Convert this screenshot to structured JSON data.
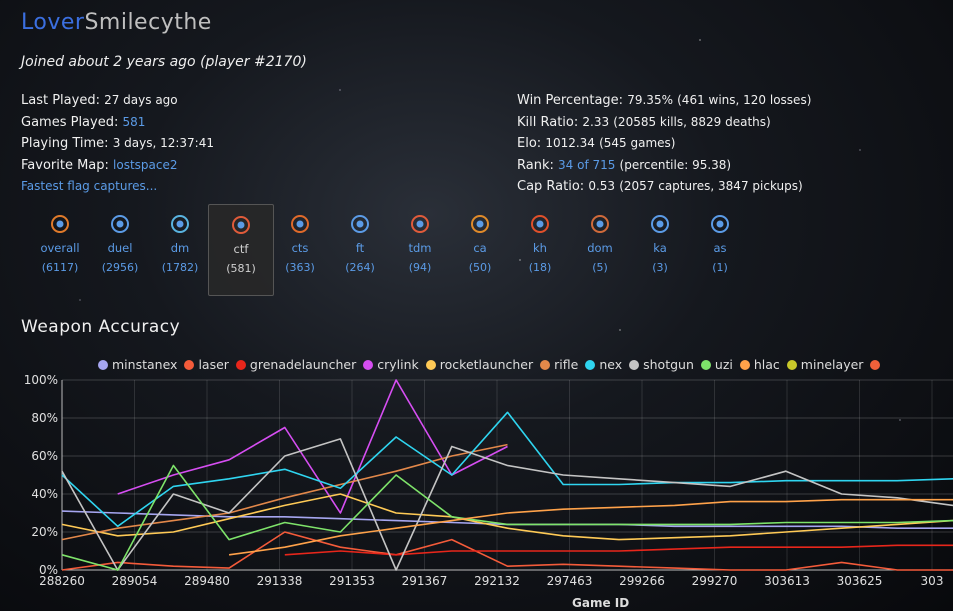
{
  "player": {
    "nick_first": "Lover",
    "nick_last": "Smilecythe",
    "joined": "Joined about 2 years ago (player #2170)"
  },
  "stats_left": {
    "last_played_label": "Last Played:",
    "last_played": "27 days ago",
    "games_played_label": "Games Played:",
    "games_played": "581",
    "playing_time_label": "Playing Time:",
    "playing_time": "3 days, 12:37:41",
    "favorite_map_label": "Favorite Map:",
    "favorite_map": "lostspace2",
    "fastest_flag": "Fastest flag captures..."
  },
  "stats_right": {
    "win_label": "Win Percentage:",
    "win_pct": "79.35%",
    "win_detail": "(461 wins, 120 losses)",
    "kill_label": "Kill Ratio:",
    "kill_ratio": "2.33",
    "kill_detail": "(20585 kills, 8829 deaths)",
    "elo_label": "Elo:",
    "elo": "1012.34",
    "elo_detail": "(545 games)",
    "rank_label": "Rank:",
    "rank": "34 of 715",
    "rank_detail": "(percentile: 95.38)",
    "cap_label": "Cap Ratio:",
    "cap_ratio": "0.53",
    "cap_detail": "(2057 captures, 3847 pickups)"
  },
  "game_modes": [
    {
      "label": "overall",
      "count": "(6117)",
      "icon": "overall-icon",
      "active": false
    },
    {
      "label": "duel",
      "count": "(2956)",
      "icon": "duel-icon",
      "active": false
    },
    {
      "label": "dm",
      "count": "(1782)",
      "icon": "dm-icon",
      "active": false
    },
    {
      "label": "ctf",
      "count": "(581)",
      "icon": "ctf-icon",
      "active": true
    },
    {
      "label": "cts",
      "count": "(363)",
      "icon": "cts-icon",
      "active": false
    },
    {
      "label": "ft",
      "count": "(264)",
      "icon": "ft-icon",
      "active": false
    },
    {
      "label": "tdm",
      "count": "(94)",
      "icon": "tdm-icon",
      "active": false
    },
    {
      "label": "ca",
      "count": "(50)",
      "icon": "ca-icon",
      "active": false
    },
    {
      "label": "kh",
      "count": "(18)",
      "icon": "kh-icon",
      "active": false
    },
    {
      "label": "dom",
      "count": "(5)",
      "icon": "dom-icon",
      "active": false
    },
    {
      "label": "ka",
      "count": "(3)",
      "icon": "ka-icon",
      "active": false
    },
    {
      "label": "as",
      "count": "(1)",
      "icon": "as-icon",
      "active": false
    }
  ],
  "weapon_accuracy_title": "Weapon Accuracy",
  "chart_data": {
    "type": "line",
    "xlabel": "Game ID",
    "ylabel": "",
    "ylim": [
      0,
      100
    ],
    "yticks": [
      "0%",
      "20%",
      "40%",
      "60%",
      "80%",
      "100%"
    ],
    "x_tick_labels": [
      "288260",
      "289054",
      "289480",
      "291338",
      "291353",
      "291367",
      "292132",
      "297463",
      "299266",
      "299270",
      "303613",
      "303625",
      "303"
    ],
    "grid": true,
    "legend_position": "top",
    "x_points": 17,
    "series": [
      {
        "name": "minstanex",
        "color": "#a6a6f0",
        "values": [
          31,
          30,
          29,
          28,
          28,
          27,
          26,
          25,
          24,
          24,
          24,
          23,
          23,
          23,
          23,
          22,
          22
        ]
      },
      {
        "name": "laser",
        "color": "#f45b3a",
        "values": [
          0,
          4,
          2,
          1,
          20,
          12,
          8,
          16,
          2,
          3,
          2,
          1,
          0,
          0,
          4,
          0,
          0
        ]
      },
      {
        "name": "grenadelauncher",
        "color": "#e8261b",
        "values": [
          null,
          null,
          null,
          null,
          8,
          10,
          8,
          10,
          10,
          10,
          10,
          11,
          12,
          12,
          12,
          13,
          13
        ]
      },
      {
        "name": "crylink",
        "color": "#d64ef2",
        "values": [
          null,
          40,
          50,
          58,
          75,
          30,
          100,
          50,
          65,
          null,
          null,
          null,
          null,
          null,
          null,
          null,
          null
        ]
      },
      {
        "name": "rocketlauncher",
        "color": "#ffca56",
        "values": [
          24,
          18,
          20,
          27,
          34,
          40,
          30,
          28,
          22,
          18,
          16,
          17,
          18,
          20,
          22,
          24,
          26
        ]
      },
      {
        "name": "rifle",
        "color": "#e2884a",
        "values": [
          16,
          22,
          26,
          30,
          38,
          45,
          52,
          60,
          66,
          null,
          null,
          null,
          null,
          null,
          null,
          null,
          null
        ]
      },
      {
        "name": "nex",
        "color": "#2fd5f0",
        "values": [
          50,
          23,
          44,
          48,
          53,
          43,
          70,
          50,
          83,
          45,
          45,
          46,
          46,
          47,
          47,
          47,
          48
        ]
      },
      {
        "name": "shotgun",
        "color": "#c4c4c4",
        "values": [
          52,
          0,
          40,
          30,
          60,
          69,
          0,
          65,
          55,
          50,
          48,
          46,
          44,
          52,
          40,
          38,
          34
        ]
      },
      {
        "name": "uzi",
        "color": "#7ee36a",
        "values": [
          8,
          0,
          55,
          16,
          25,
          20,
          50,
          28,
          24,
          24,
          24,
          24,
          24,
          25,
          25,
          25,
          26
        ]
      },
      {
        "name": "hlac",
        "color": "#ffa24a",
        "values": [
          null,
          null,
          null,
          8,
          12,
          18,
          22,
          26,
          30,
          32,
          33,
          34,
          36,
          36,
          37,
          37,
          37
        ]
      },
      {
        "name": "minelayer",
        "color": "#c8c82a",
        "values": [
          null,
          null,
          null,
          null,
          null,
          null,
          null,
          null,
          null,
          null,
          null,
          null,
          null,
          null,
          null,
          null,
          null
        ]
      },
      {
        "name": "",
        "color": "#f0603a",
        "values": []
      }
    ]
  }
}
